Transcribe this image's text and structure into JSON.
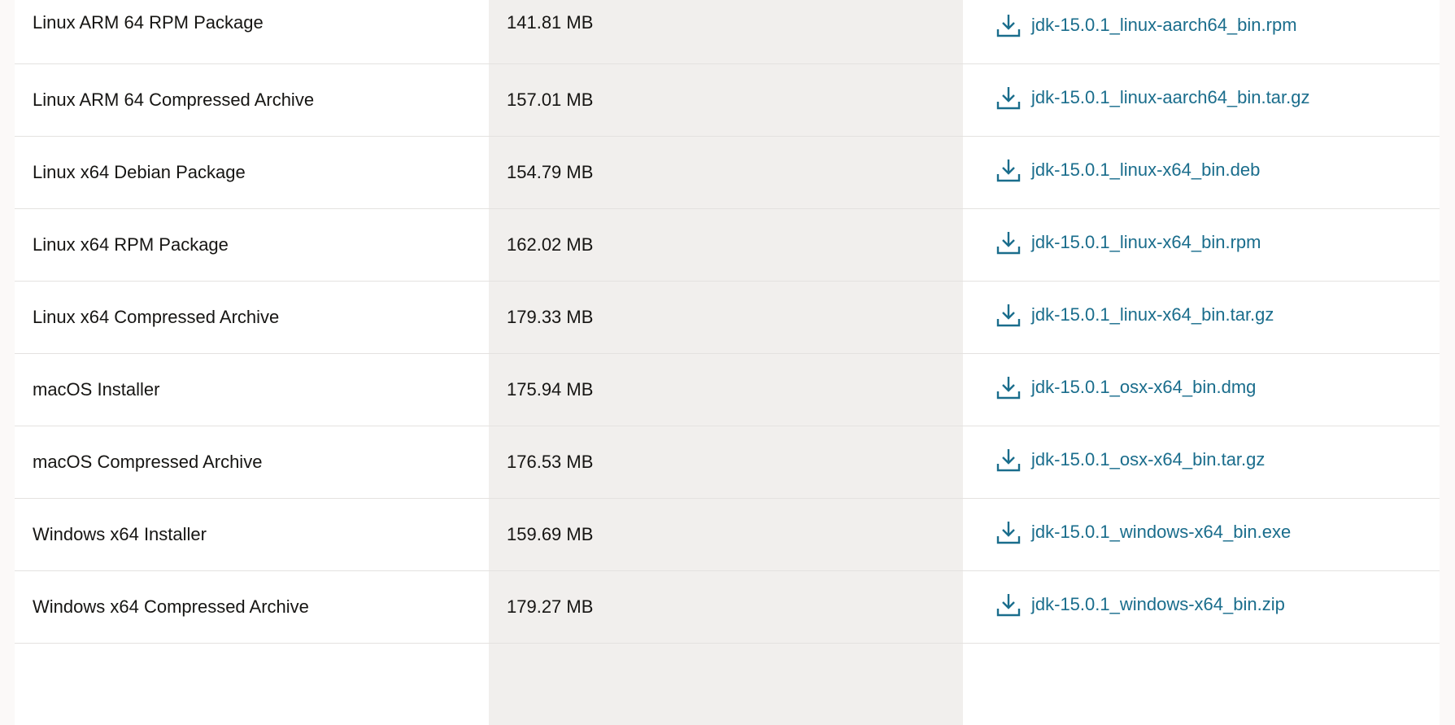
{
  "downloads": {
    "accent_color": "#1a6d8c",
    "icon": "download-icon",
    "rows": [
      {
        "product": "Linux ARM 64 RPM Package",
        "size": "141.81 MB",
        "file": "jdk-15.0.1_linux-aarch64_bin.rpm"
      },
      {
        "product": "Linux ARM 64 Compressed Archive",
        "size": "157.01 MB",
        "file": "jdk-15.0.1_linux-aarch64_bin.tar.gz"
      },
      {
        "product": "Linux x64 Debian Package",
        "size": "154.79 MB",
        "file": "jdk-15.0.1_linux-x64_bin.deb"
      },
      {
        "product": "Linux x64 RPM Package",
        "size": "162.02 MB",
        "file": "jdk-15.0.1_linux-x64_bin.rpm"
      },
      {
        "product": "Linux x64 Compressed Archive",
        "size": "179.33 MB",
        "file": "jdk-15.0.1_linux-x64_bin.tar.gz"
      },
      {
        "product": "macOS Installer",
        "size": "175.94 MB",
        "file": "jdk-15.0.1_osx-x64_bin.dmg"
      },
      {
        "product": "macOS Compressed Archive",
        "size": "176.53 MB",
        "file": "jdk-15.0.1_osx-x64_bin.tar.gz"
      },
      {
        "product": "Windows x64 Installer",
        "size": "159.69 MB",
        "file": "jdk-15.0.1_windows-x64_bin.exe"
      },
      {
        "product": "Windows x64 Compressed Archive",
        "size": "179.27 MB",
        "file": "jdk-15.0.1_windows-x64_bin.zip"
      }
    ]
  }
}
